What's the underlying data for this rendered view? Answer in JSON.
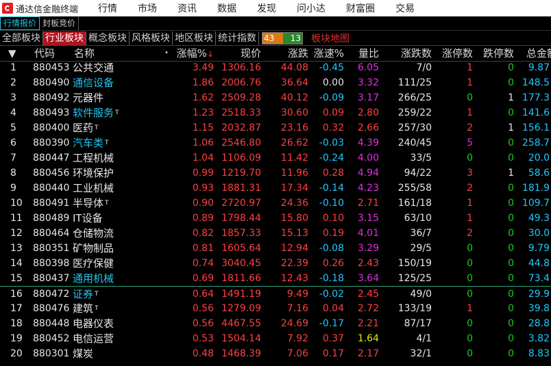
{
  "app": {
    "title": "通达信金融终端"
  },
  "menu": [
    "行情",
    "市场",
    "资讯",
    "数据",
    "发现",
    "问小达",
    "财富圈",
    "交易"
  ],
  "subtabs": [
    "行情报价",
    "封板竞价"
  ],
  "board_tabs": [
    "全部板块",
    "行业板块",
    "概念板块",
    "风格板块",
    "地区板块",
    "统计指数"
  ],
  "active_board_tab": 1,
  "counts": {
    "up": "43",
    "down": "13"
  },
  "map_button": "板块地图",
  "columns": {
    "seq": "",
    "code": "代码",
    "name": "名称",
    "name_dot": "•",
    "pct": "涨幅%",
    "pct_arrow": "↓",
    "price": "现价",
    "change": "涨跌",
    "speed": "涨速%",
    "vol_ratio": "量比",
    "updown": "涨跌数",
    "limit_up": "涨停数",
    "limit_down": "跌停数",
    "total": "总金额"
  },
  "colors": {
    "red": "#ff4040",
    "green": "#18d018",
    "magenta": "#e030e0",
    "yellow": "#e8e800",
    "cyan": "#20c8ff"
  },
  "rows": [
    {
      "seq": "1",
      "code": "880453",
      "name": "公共交通",
      "tag": false,
      "pct": "3.49",
      "price": "1306.16",
      "change": "44.08",
      "speed": "-0.45",
      "vr": "6.05",
      "ud": "7/0",
      "lu": "1",
      "ld": "0",
      "total": "9.87"
    },
    {
      "seq": "2",
      "code": "880490",
      "name": "通信设备",
      "tag": false,
      "pct": "1.86",
      "price": "2006.76",
      "change": "36.64",
      "speed": "0.00",
      "vr": "3.32",
      "ud": "111/25",
      "lu": "1",
      "ld": "0",
      "total": "148.5"
    },
    {
      "seq": "3",
      "code": "880492",
      "name": "元器件",
      "tag": false,
      "pct": "1.62",
      "price": "2509.28",
      "change": "40.12",
      "speed": "-0.09",
      "vr": "3.17",
      "ud": "266/25",
      "lu": "0",
      "ld": "1",
      "total": "177.3"
    },
    {
      "seq": "4",
      "code": "880493",
      "name": "软件服务",
      "tag": true,
      "pct": "1.23",
      "price": "2518.33",
      "change": "30.60",
      "speed": "0.09",
      "vr": "2.80",
      "ud": "259/22",
      "lu": "1",
      "ld": "0",
      "total": "141.6"
    },
    {
      "seq": "5",
      "code": "880400",
      "name": "医药",
      "tag": true,
      "pct": "1.15",
      "price": "2032.87",
      "change": "23.16",
      "speed": "0.32",
      "vr": "2.66",
      "ud": "257/30",
      "lu": "2",
      "ld": "1",
      "total": "156.1"
    },
    {
      "seq": "6",
      "code": "880390",
      "name": "汽车类",
      "tag": true,
      "pct": "1.06",
      "price": "2546.80",
      "change": "26.62",
      "speed": "-0.03",
      "vr": "4.39",
      "ud": "240/45",
      "lu": "5",
      "ld": "0",
      "total": "258.7"
    },
    {
      "seq": "7",
      "code": "880447",
      "name": "工程机械",
      "tag": false,
      "pct": "1.04",
      "price": "1106.09",
      "change": "11.42",
      "speed": "-0.24",
      "vr": "4.00",
      "ud": "33/5",
      "lu": "0",
      "ld": "0",
      "total": "20.0"
    },
    {
      "seq": "8",
      "code": "880456",
      "name": "环境保护",
      "tag": false,
      "pct": "0.99",
      "price": "1219.70",
      "change": "11.96",
      "speed": "0.28",
      "vr": "4.94",
      "ud": "94/22",
      "lu": "3",
      "ld": "1",
      "total": "58.6"
    },
    {
      "seq": "9",
      "code": "880440",
      "name": "工业机械",
      "tag": false,
      "pct": "0.93",
      "price": "1881.31",
      "change": "17.34",
      "speed": "-0.14",
      "vr": "4.23",
      "ud": "255/58",
      "lu": "2",
      "ld": "0",
      "total": "181.9"
    },
    {
      "seq": "10",
      "code": "880491",
      "name": "半导体",
      "tag": true,
      "pct": "0.90",
      "price": "2720.97",
      "change": "24.36",
      "speed": "-0.10",
      "vr": "2.71",
      "ud": "161/18",
      "lu": "1",
      "ld": "0",
      "total": "109.7"
    },
    {
      "seq": "11",
      "code": "880489",
      "name": "IT设备",
      "tag": false,
      "pct": "0.89",
      "price": "1798.44",
      "change": "15.80",
      "speed": "0.10",
      "vr": "3.15",
      "ud": "63/10",
      "lu": "1",
      "ld": "0",
      "total": "49.3"
    },
    {
      "seq": "12",
      "code": "880464",
      "name": "仓储物流",
      "tag": false,
      "pct": "0.82",
      "price": "1857.33",
      "change": "15.13",
      "speed": "0.19",
      "vr": "4.01",
      "ud": "36/7",
      "lu": "2",
      "ld": "0",
      "total": "30.0"
    },
    {
      "seq": "13",
      "code": "880351",
      "name": "矿物制品",
      "tag": false,
      "pct": "0.81",
      "price": "1605.64",
      "change": "12.94",
      "speed": "-0.08",
      "vr": "3.29",
      "ud": "29/5",
      "lu": "0",
      "ld": "0",
      "total": "9.79"
    },
    {
      "seq": "14",
      "code": "880398",
      "name": "医疗保健",
      "tag": false,
      "pct": "0.74",
      "price": "3040.45",
      "change": "22.39",
      "speed": "0.26",
      "vr": "2.43",
      "ud": "150/19",
      "lu": "0",
      "ld": "0",
      "total": "44.8"
    },
    {
      "seq": "15",
      "code": "880437",
      "name": "通用机械",
      "tag": false,
      "pct": "0.69",
      "price": "1811.66",
      "change": "12.43",
      "speed": "-0.18",
      "vr": "3.64",
      "ud": "125/25",
      "lu": "0",
      "ld": "0",
      "total": "73.4"
    },
    {
      "seq": "16",
      "code": "880472",
      "name": "证券",
      "tag": true,
      "pct": "0.64",
      "price": "1491.19",
      "change": "9.49",
      "speed": "-0.02",
      "vr": "2.45",
      "ud": "49/0",
      "lu": "0",
      "ld": "0",
      "total": "29.9"
    },
    {
      "seq": "17",
      "code": "880476",
      "name": "建筑",
      "tag": true,
      "pct": "0.56",
      "price": "1279.09",
      "change": "7.16",
      "speed": "0.04",
      "vr": "2.72",
      "ud": "133/19",
      "lu": "1",
      "ld": "0",
      "total": "39.8"
    },
    {
      "seq": "18",
      "code": "880448",
      "name": "电器仪表",
      "tag": false,
      "pct": "0.56",
      "price": "4467.55",
      "change": "24.69",
      "speed": "-0.17",
      "vr": "2.21",
      "ud": "87/17",
      "lu": "0",
      "ld": "0",
      "total": "28.8"
    },
    {
      "seq": "19",
      "code": "880452",
      "name": "电信运营",
      "tag": false,
      "pct": "0.53",
      "price": "1504.14",
      "change": "7.92",
      "speed": "0.37",
      "vr": "1.64",
      "ud": "4/1",
      "lu": "0",
      "ld": "0",
      "total": "3.82"
    },
    {
      "seq": "20",
      "code": "880301",
      "name": "煤炭",
      "tag": false,
      "pct": "0.48",
      "price": "1468.39",
      "change": "7.06",
      "speed": "0.17",
      "vr": "2.17",
      "ud": "32/1",
      "lu": "0",
      "ld": "0",
      "total": "8.83"
    }
  ],
  "tag_char": "T"
}
